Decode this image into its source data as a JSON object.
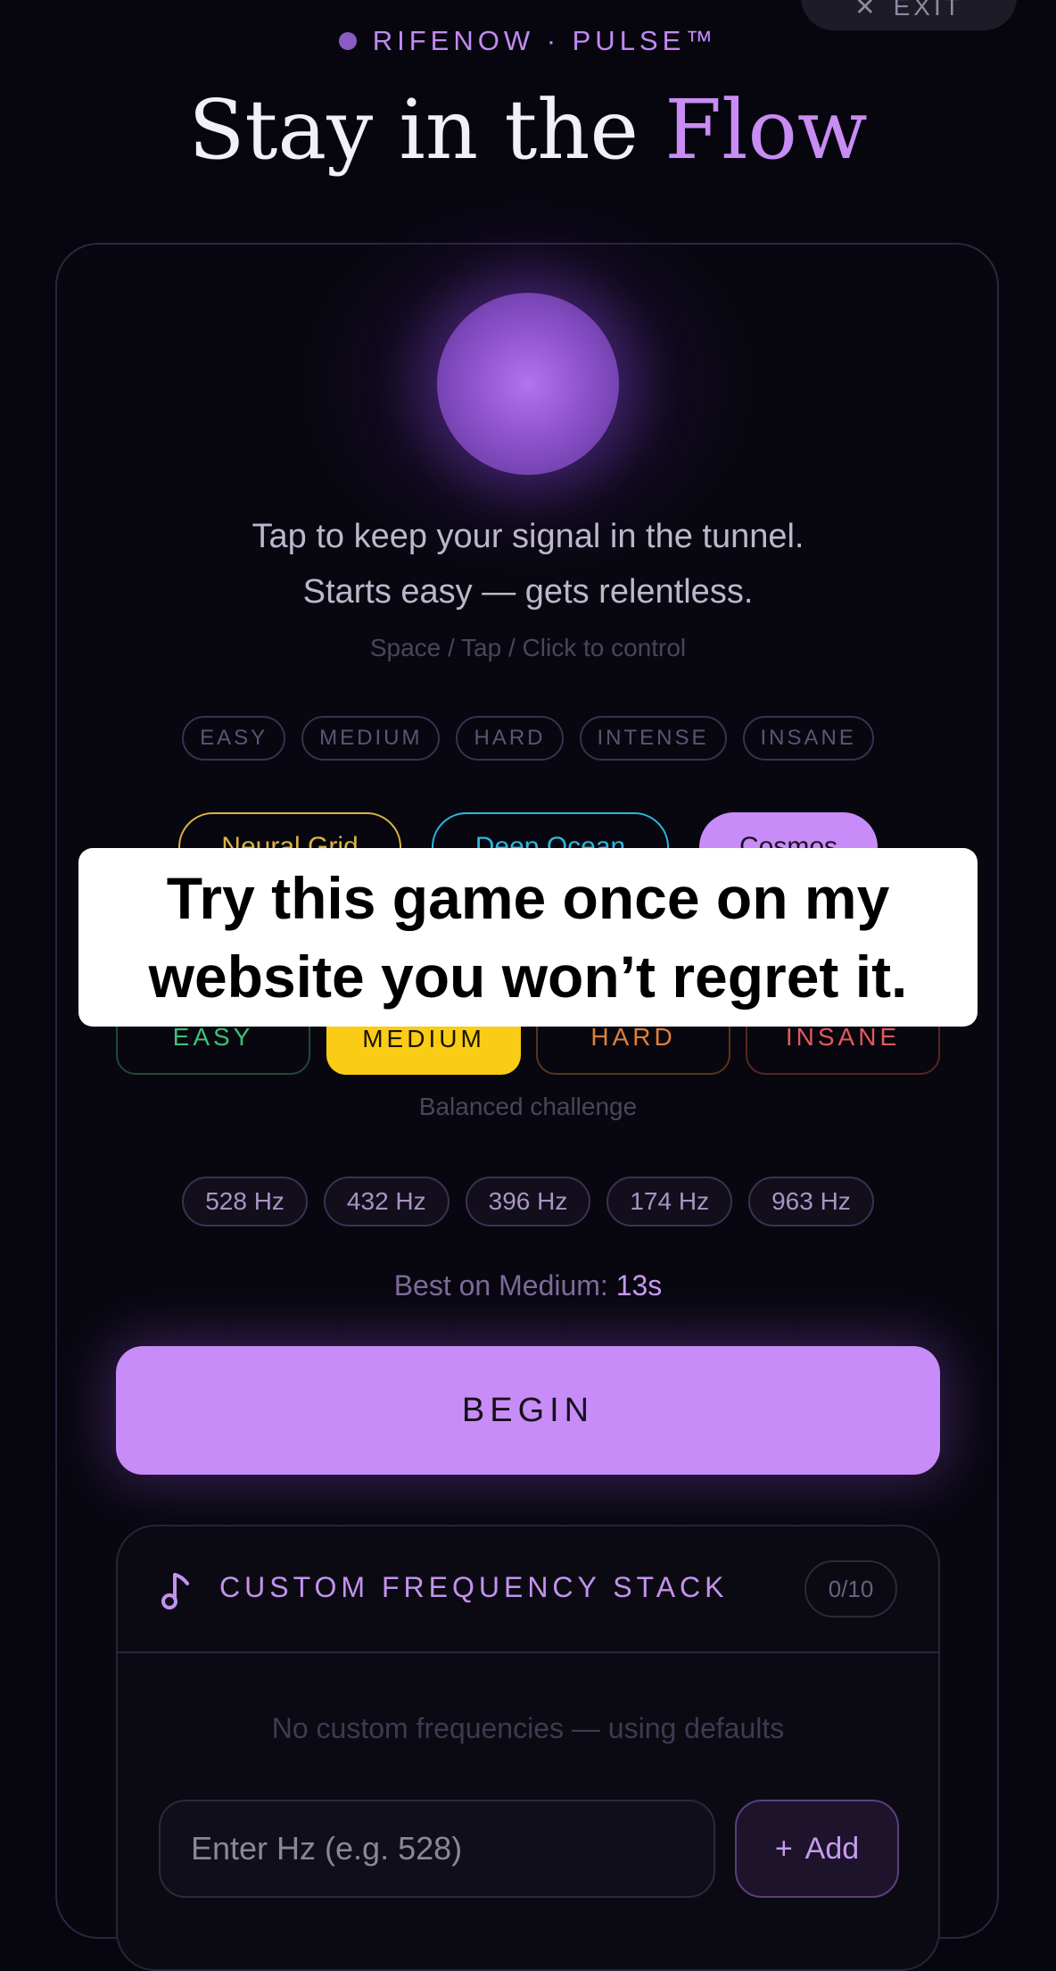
{
  "header": {
    "exit_icon": "close-icon",
    "exit_label": "EXIT",
    "brand": "RIFENOW · PULSE™",
    "title_main": "Stay in the ",
    "title_accent": "Flow"
  },
  "game": {
    "line1": "Tap to keep your signal in the tunnel.",
    "line2": "Starts easy — gets relentless.",
    "hint": "Space / Tap / Click to control"
  },
  "levels": [
    "EASY",
    "MEDIUM",
    "HARD",
    "INTENSE",
    "INSANE"
  ],
  "themes": [
    {
      "label": "Neural Grid",
      "color": "#d9b445"
    },
    {
      "label": "Deep Ocean",
      "color": "#2ab8e0"
    },
    {
      "label": "Cosmos",
      "color": "#c88cf8",
      "selected": true
    }
  ],
  "difficulty": {
    "options": [
      {
        "label": "EASY",
        "color": "#3fbf78"
      },
      {
        "label": "MEDIUM",
        "color": "#facc15",
        "selected": true
      },
      {
        "label": "HARD",
        "color": "#e0803a"
      },
      {
        "label": "INSANE",
        "color": "#e05a5a"
      }
    ],
    "description": "Balanced challenge"
  },
  "frequencies": [
    "528 Hz",
    "432 Hz",
    "396 Hz",
    "174 Hz",
    "963 Hz"
  ],
  "best": {
    "label": "Best on Medium: ",
    "value": "13s"
  },
  "begin_label": "BEGIN",
  "stack": {
    "icon": "music-note-icon",
    "title": "CUSTOM FREQUENCY STACK",
    "count": "0/10",
    "empty": "No custom frequencies — using defaults",
    "input_placeholder": "Enter Hz (e.g. 528)",
    "add_label": "Add"
  },
  "overlay_caption": "Try this game once on my website you won’t regret it."
}
